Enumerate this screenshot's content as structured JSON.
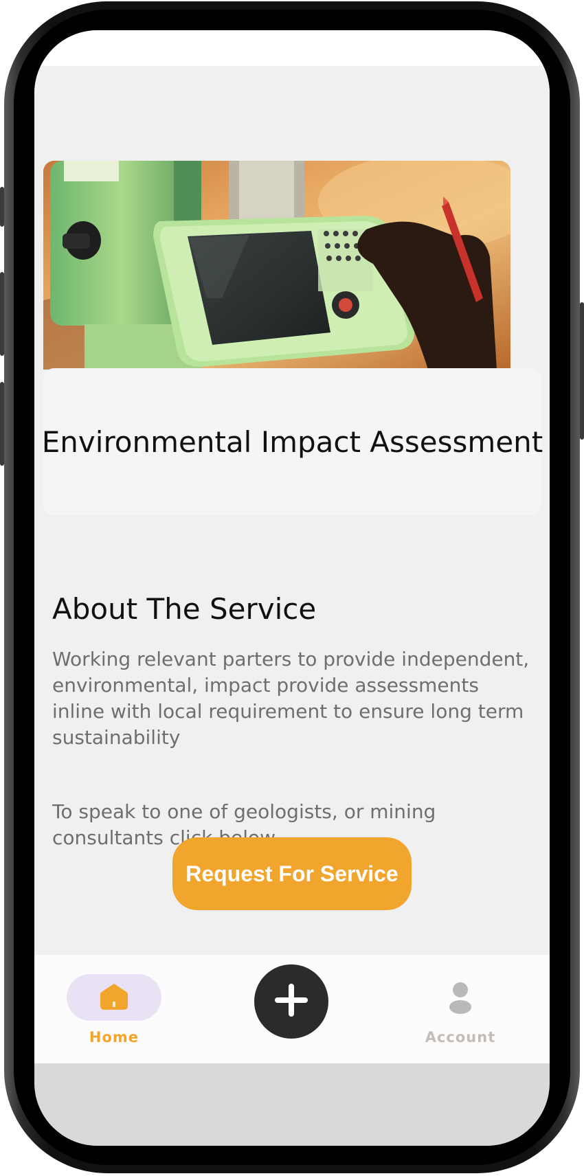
{
  "service": {
    "title": "Environmental Impact Assessment",
    "hero_image_alt": "surveying-instrument-photo"
  },
  "about": {
    "heading": "About The Service",
    "paragraph1": "Working relevant parters to provide independent, environmental, impact provide assessments inline with local requirement to ensure long term sustainability",
    "paragraph2": "To speak to one of geologists, or mining consultants click below",
    "button_label": "Request For Service"
  },
  "nav": {
    "home_label": "Home",
    "account_label": "Account",
    "home_icon": "home-icon",
    "add_icon": "plus-icon",
    "account_icon": "user-icon"
  },
  "colors": {
    "accent": "#f2a52c",
    "nav_active_bg": "#e9e2f5",
    "fab_bg": "#2b2b2b",
    "inactive": "#c4bcb6"
  }
}
